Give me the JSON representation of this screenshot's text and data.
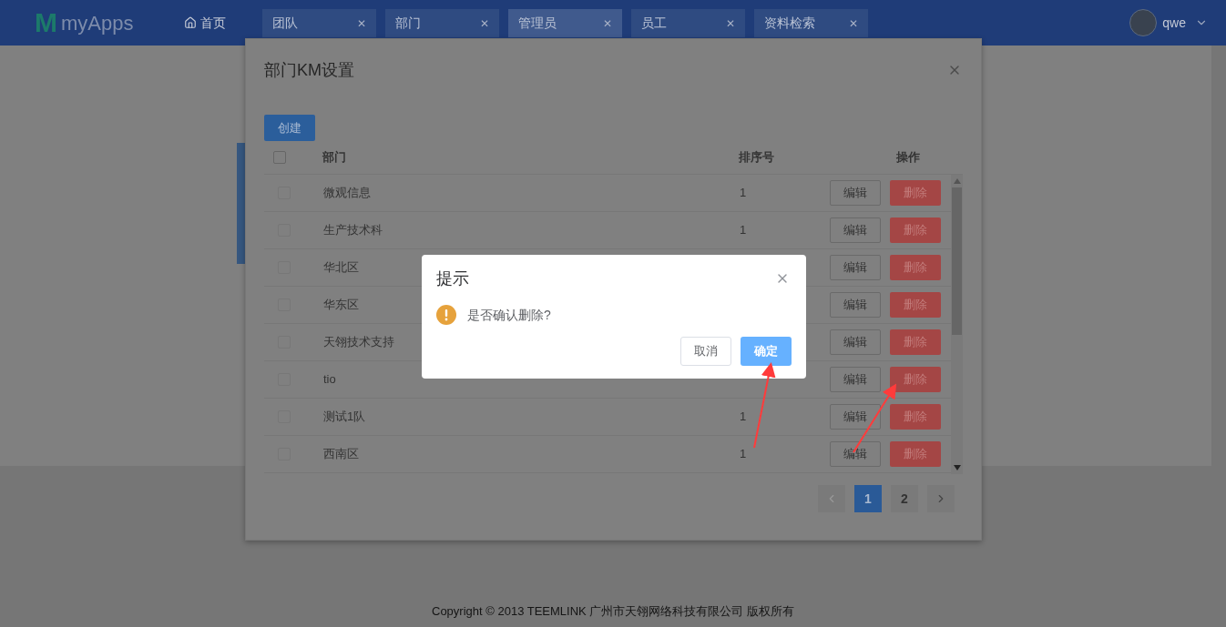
{
  "header": {
    "logo_mark": "M",
    "logo": "myApps",
    "home": "首页",
    "user": "qwe",
    "tabs": [
      {
        "label": "团队",
        "selected": false,
        "close": "✕"
      },
      {
        "label": "部门",
        "selected": false,
        "close": "✕"
      },
      {
        "label": "管理员",
        "selected": true,
        "close": "✕"
      },
      {
        "label": "员工",
        "selected": false,
        "close": "✕"
      },
      {
        "label": "资料检索",
        "selected": false,
        "close": "✕"
      }
    ]
  },
  "km_dialog": {
    "title": "部门KM设置",
    "create_button": "创建",
    "select_all_checked": false,
    "columns": [
      "部门",
      "排序号",
      "操作"
    ],
    "rows": [
      {
        "name": "微观信息",
        "order": "1",
        "checked": false,
        "edit": "编辑",
        "delete": "删除"
      },
      {
        "name": "生产技术科",
        "order": "1",
        "checked": false,
        "edit": "编辑",
        "delete": "删除"
      },
      {
        "name": "华北区",
        "checked": false,
        "edit": "编辑",
        "delete": "删除"
      },
      {
        "name": "华东区",
        "checked": false,
        "edit": "编辑",
        "delete": "删除"
      },
      {
        "name": "天翎技术支持",
        "checked": false,
        "edit": "编辑",
        "delete": "删除"
      },
      {
        "name": "tio",
        "checked": false,
        "edit": "编辑",
        "delete": "删除"
      },
      {
        "name": "测试1队",
        "order": "1",
        "checked": false,
        "edit": "编辑",
        "delete": "删除"
      },
      {
        "name": "西南区",
        "order": "1",
        "checked": false,
        "edit": "编辑",
        "delete": "删除"
      }
    ],
    "pages": [
      {
        "label": "1",
        "selected": true
      },
      {
        "label": "2",
        "selected": false
      }
    ]
  },
  "confirm": {
    "title": "提示",
    "message": "是否确认删除?",
    "cancel": "取消",
    "ok": "确定"
  },
  "footer": "Copyright © 2013 TEEMLINK 广州市天翎网络科技有限公司 版权所有"
}
